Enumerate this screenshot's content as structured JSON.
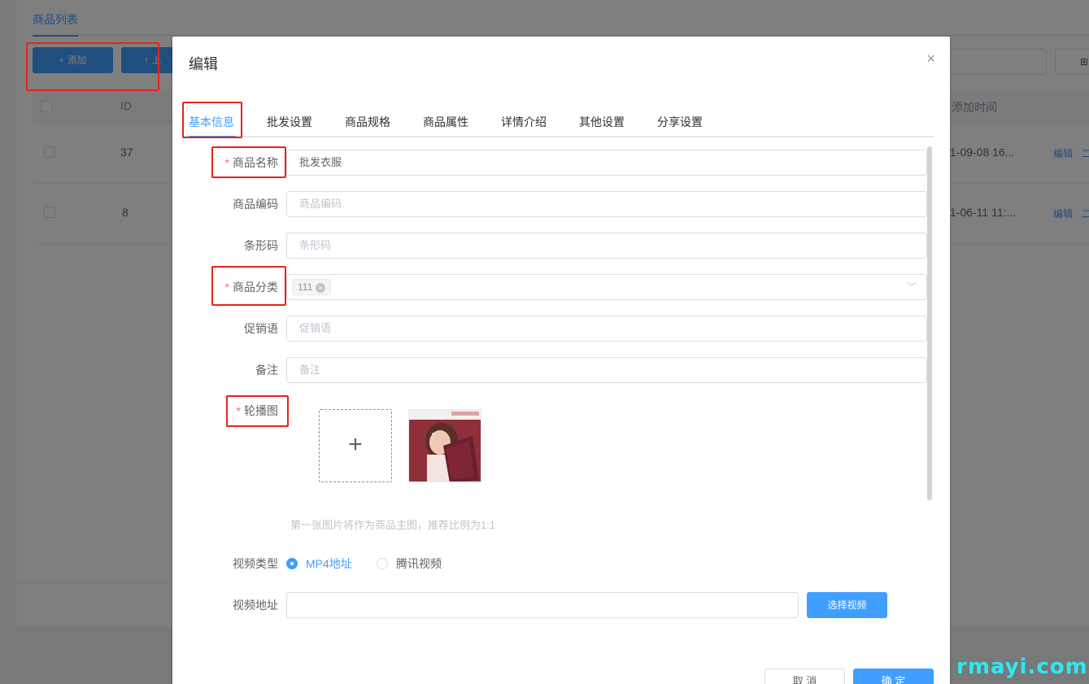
{
  "background": {
    "tab": "商品列表",
    "add_button": "+ 添加",
    "upload_button": "↑ 上",
    "grid_icon": "⊞",
    "columns": {
      "id": "ID",
      "added_time": "添加时间"
    },
    "rows": [
      {
        "id": "37",
        "time": "1-09-08 16...",
        "edit": "编辑",
        "more": "二"
      },
      {
        "id": "8",
        "time": "1-06-11 11:...",
        "edit": "编辑",
        "more": "二"
      }
    ]
  },
  "dialog": {
    "title": "编辑",
    "close": "×",
    "tabs": [
      "基本信息",
      "批发设置",
      "商品规格",
      "商品属性",
      "详情介绍",
      "其他设置",
      "分享设置"
    ],
    "form": {
      "name_label": "商品名称",
      "name_value": "批发衣服",
      "code_label": "商品编码",
      "code_placeholder": "商品编码",
      "barcode_label": "条形码",
      "barcode_placeholder": "条形码",
      "category_label": "商品分类",
      "category_tag": "111",
      "category_tag_close": "×",
      "category_arrow": "﹀",
      "promo_label": "促销语",
      "promo_placeholder": "促销语",
      "remark_label": "备注",
      "remark_placeholder": "备注",
      "carousel_label": "轮播图",
      "upload_plus": "+",
      "hint": "第一张图片将作为商品主图，推荐比例为1:1",
      "video_type_label": "视频类型",
      "video_type_options": [
        "MP4地址",
        "腾讯视频"
      ],
      "video_type_selected": "MP4地址",
      "video_url_label": "视频地址",
      "video_url_value": "",
      "select_video_button": "选择视频"
    },
    "footer": {
      "cancel": "取 消",
      "confirm": "确 定"
    }
  },
  "required_mark": "*",
  "watermark": "rmayi.com",
  "colors": {
    "primary": "#409eff",
    "annotation": "#e8231a",
    "required": "#f56c6c",
    "watermark": "#2ee8ef"
  }
}
